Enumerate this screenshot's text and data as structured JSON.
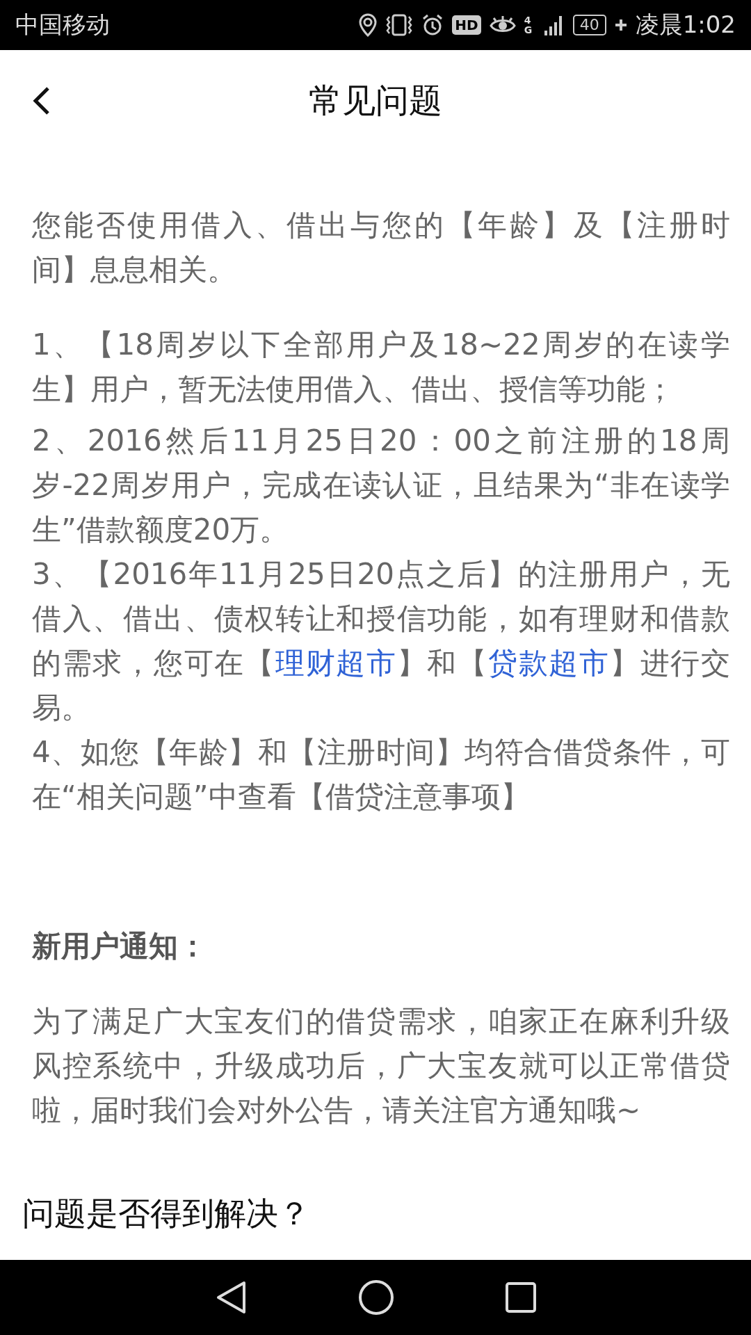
{
  "status_bar": {
    "carrier": "中国移动",
    "hd": "HD",
    "network": "4G",
    "battery": "40",
    "time": "凌晨1:02"
  },
  "header": {
    "title": "常见问题"
  },
  "faq": {
    "intro": "您能否使用借入、借出与您的【年龄】及【注册时间】息息相关。",
    "items": [
      {
        "segments": [
          {
            "kind": "text",
            "text": "1、【18周岁以下全部用户及18~22周岁的在读学生】用户，暂无法使用借入、借出、授信等功能；"
          }
        ]
      },
      {
        "segments": [
          {
            "kind": "text",
            "text": "2、2016然后11月25日20：00之前注册的18周岁-22周岁用户，完成在读认证，且结果为“非在读学生”借款额度20万。"
          }
        ]
      },
      {
        "segments": [
          {
            "kind": "text",
            "text": "3、【2016年11月25日20点之后】的注册用户，无借入、借出、债权转让和授信功能，如有理财和借款的需求，您可在【"
          },
          {
            "kind": "link",
            "text": "理财超市"
          },
          {
            "kind": "text",
            "text": "】和【"
          },
          {
            "kind": "link",
            "text": "贷款超市"
          },
          {
            "kind": "text",
            "text": "】进行交易。"
          }
        ]
      },
      {
        "segments": [
          {
            "kind": "text",
            "text": "4、如您【年龄】和【注册时间】均符合借贷条件，可在“相关问题”中查看【借贷注意事项】"
          }
        ]
      }
    ]
  },
  "notice": {
    "heading": "新用户通知：",
    "body": "为了满足广大宝友们的借贷需求，咱家正在麻利升级风控系统中，升级成功后，广大宝友就可以正常借贷啦，届时我们会对外公告，请关注官方通知哦~"
  },
  "feedback": {
    "question": "问题是否得到解决？"
  }
}
